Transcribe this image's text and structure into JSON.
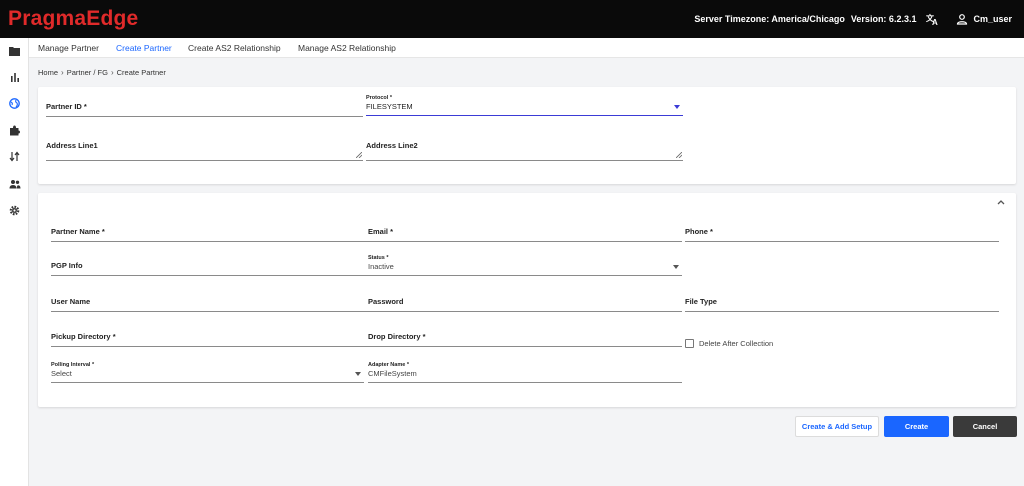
{
  "app": {
    "logo": "PragmaEdge"
  },
  "header": {
    "timezone": "Server Timezone: America/Chicago",
    "version": "Version: 6.2.3.1",
    "user": "Cm_user"
  },
  "sidebar": {
    "icons": [
      "folder-icon",
      "chart-icon",
      "globe-icon",
      "puzzle-icon",
      "transfer-icon",
      "users-icon",
      "gear-icon"
    ]
  },
  "subnav": {
    "items": [
      {
        "label": "Manage Partner"
      },
      {
        "label": "Create Partner"
      },
      {
        "label": "Create AS2 Relationship"
      },
      {
        "label": "Manage AS2 Relationship"
      }
    ]
  },
  "breadcrumb": {
    "home": "Home",
    "partner": "Partner / FG",
    "current": "Create Partner"
  },
  "form1": {
    "partner_id": {
      "label": "Partner ID *"
    },
    "protocol": {
      "label": "Protocol *",
      "value": "FILESYSTEM"
    },
    "address1": {
      "label": "Address Line1"
    },
    "address2": {
      "label": "Address Line2"
    }
  },
  "form2": {
    "partner_name": {
      "label": "Partner Name *"
    },
    "email": {
      "label": "Email *"
    },
    "phone": {
      "label": "Phone *"
    },
    "pgp_info": {
      "label": "PGP Info"
    },
    "status": {
      "label": "Status *",
      "value": "Inactive"
    },
    "user_name": {
      "label": "User Name"
    },
    "password": {
      "label": "Password"
    },
    "file_type": {
      "label": "File Type"
    },
    "pickup_directory": {
      "label": "Pickup Directory *"
    },
    "drop_directory": {
      "label": "Drop Directory *"
    },
    "delete_after_collection": {
      "label": "Delete After Collection",
      "checked": false
    },
    "polling_interval": {
      "label": "Polling Interval *",
      "value": "Select"
    },
    "adapter_name": {
      "label": "Adapter Name *",
      "value": "CMFileSystem"
    }
  },
  "actions": {
    "create_add_setup": "Create & Add Setup",
    "create": "Create",
    "cancel": "Cancel"
  },
  "colors": {
    "logo": "#e02a2a",
    "primary": "#1a66ff",
    "active_underline": "#3b3bd6",
    "topbar": "#0a0a0a",
    "cancel_bg": "#3a3a3a"
  }
}
